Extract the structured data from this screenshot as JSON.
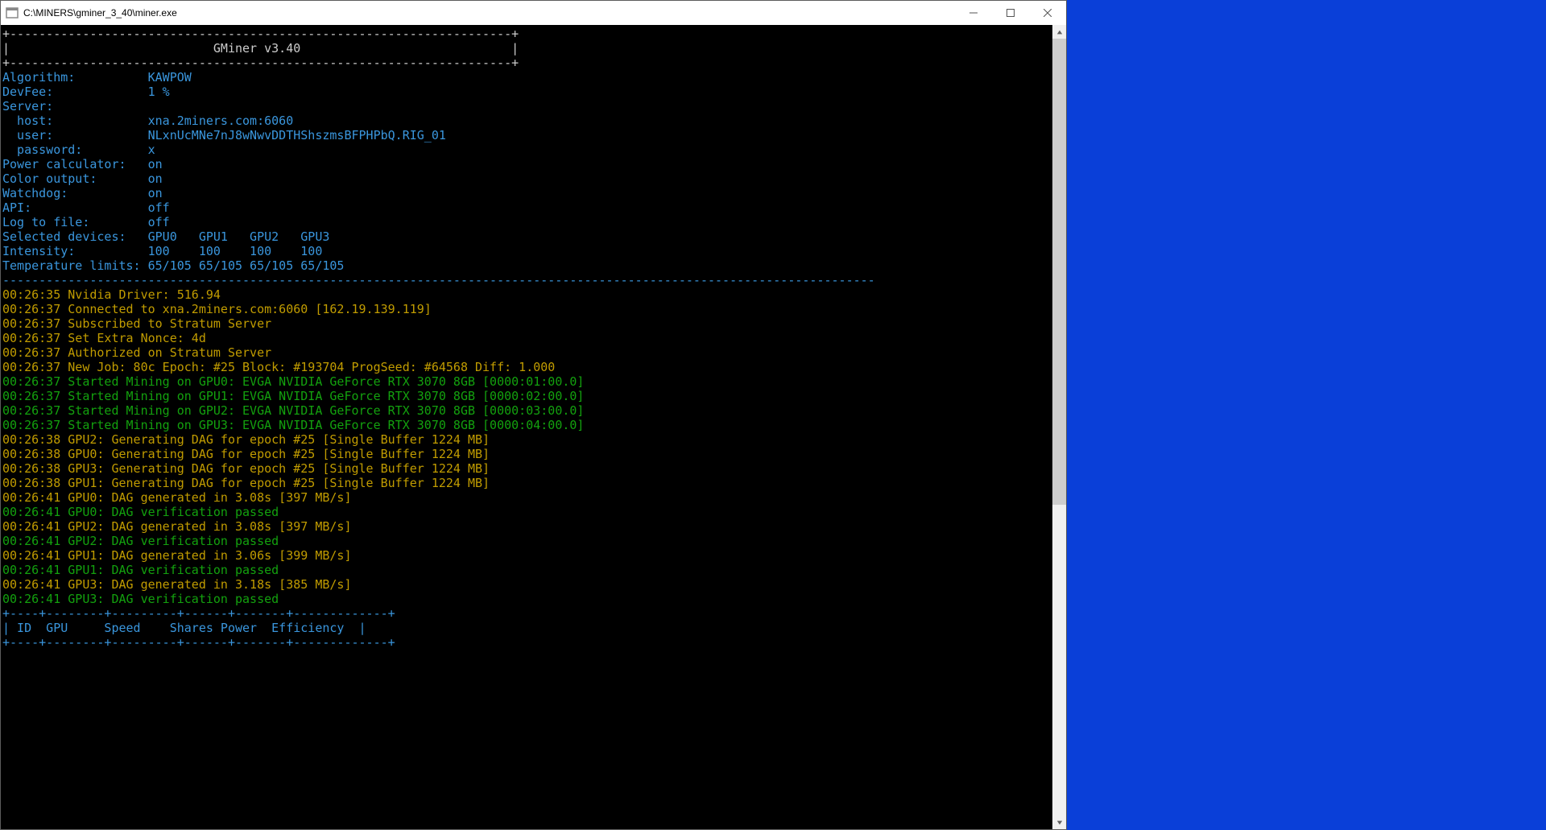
{
  "window": {
    "title": "C:\\MINERS\\gminer_3_40\\miner.exe"
  },
  "header": {
    "border_top": "+---------------------------------------------------------------------+",
    "title_line": "|                            GMiner v3.40                             |",
    "border_bot": "+---------------------------------------------------------------------+"
  },
  "config": {
    "algorithm_label": "Algorithm:          ",
    "algorithm_value": "KAWPOW",
    "devfee_label": "DevFee:             ",
    "devfee_value": "1 %",
    "server_label": "Server:",
    "host_label": "  host:             ",
    "host_value": "xna.2miners.com:6060",
    "user_label": "  user:             ",
    "user_value": "NLxnUcMNe7nJ8wNwvDDTHShszmsBFPHPbQ.RIG_01",
    "password_label": "  password:         ",
    "password_value": "x",
    "powercalc_label": "Power calculator:   ",
    "powercalc_value": "on",
    "color_label": "Color output:       ",
    "color_value": "on",
    "watchdog_label": "Watchdog:           ",
    "watchdog_value": "on",
    "api_label": "API:                ",
    "api_value": "off",
    "logfile_label": "Log to file:        ",
    "logfile_value": "off",
    "seldev_label": "Selected devices:   ",
    "seldev_value": "GPU0   GPU1   GPU2   GPU3",
    "intensity_label": "Intensity:          ",
    "intensity_value": "100    100    100    100",
    "templimit_label": "Temperature limits: ",
    "templimit_value": "65/105 65/105 65/105 65/105",
    "divider": "------------------------------------------------------------------------------------------------------------------------"
  },
  "log": [
    {
      "cls": "c-yellow",
      "text": "00:26:35 Nvidia Driver: 516.94"
    },
    {
      "cls": "c-yellow",
      "text": "00:26:37 Connected to xna.2miners.com:6060 [162.19.139.119]"
    },
    {
      "cls": "c-yellow",
      "text": "00:26:37 Subscribed to Stratum Server"
    },
    {
      "cls": "c-yellow",
      "text": "00:26:37 Set Extra Nonce: 4d"
    },
    {
      "cls": "c-yellow",
      "text": "00:26:37 Authorized on Stratum Server"
    },
    {
      "cls": "c-yellow",
      "text": "00:26:37 New Job: 80c Epoch: #25 Block: #193704 ProgSeed: #64568 Diff: 1.000"
    },
    {
      "cls": "c-green",
      "text": "00:26:37 Started Mining on GPU0: EVGA NVIDIA GeForce RTX 3070 8GB [0000:01:00.0]"
    },
    {
      "cls": "c-green",
      "text": "00:26:37 Started Mining on GPU1: EVGA NVIDIA GeForce RTX 3070 8GB [0000:02:00.0]"
    },
    {
      "cls": "c-green",
      "text": "00:26:37 Started Mining on GPU2: EVGA NVIDIA GeForce RTX 3070 8GB [0000:03:00.0]"
    },
    {
      "cls": "c-green",
      "text": "00:26:37 Started Mining on GPU3: EVGA NVIDIA GeForce RTX 3070 8GB [0000:04:00.0]"
    },
    {
      "cls": "c-yellow",
      "text": "00:26:38 GPU2: Generating DAG for epoch #25 [Single Buffer 1224 MB]"
    },
    {
      "cls": "c-yellow",
      "text": "00:26:38 GPU0: Generating DAG for epoch #25 [Single Buffer 1224 MB]"
    },
    {
      "cls": "c-yellow",
      "text": "00:26:38 GPU3: Generating DAG for epoch #25 [Single Buffer 1224 MB]"
    },
    {
      "cls": "c-yellow",
      "text": "00:26:38 GPU1: Generating DAG for epoch #25 [Single Buffer 1224 MB]"
    },
    {
      "cls": "c-yellow",
      "text": "00:26:41 GPU0: DAG generated in 3.08s [397 MB/s]"
    },
    {
      "cls": "c-green",
      "text": "00:26:41 GPU0: DAG verification passed"
    },
    {
      "cls": "c-yellow",
      "text": "00:26:41 GPU2: DAG generated in 3.08s [397 MB/s]"
    },
    {
      "cls": "c-green",
      "text": "00:26:41 GPU2: DAG verification passed"
    },
    {
      "cls": "c-yellow",
      "text": "00:26:41 GPU1: DAG generated in 3.06s [399 MB/s]"
    },
    {
      "cls": "c-green",
      "text": "00:26:41 GPU1: DAG verification passed"
    },
    {
      "cls": "c-yellow",
      "text": "00:26:41 GPU3: DAG generated in 3.18s [385 MB/s]"
    },
    {
      "cls": "c-green",
      "text": "00:26:41 GPU3: DAG verification passed"
    }
  ],
  "table": {
    "border": "+----+--------+---------+------+-------+-------------+",
    "header": "| ID  GPU     Speed    Shares Power  Efficiency  |",
    "border2": "+----+--------+---------+------+-------+-------------+"
  }
}
